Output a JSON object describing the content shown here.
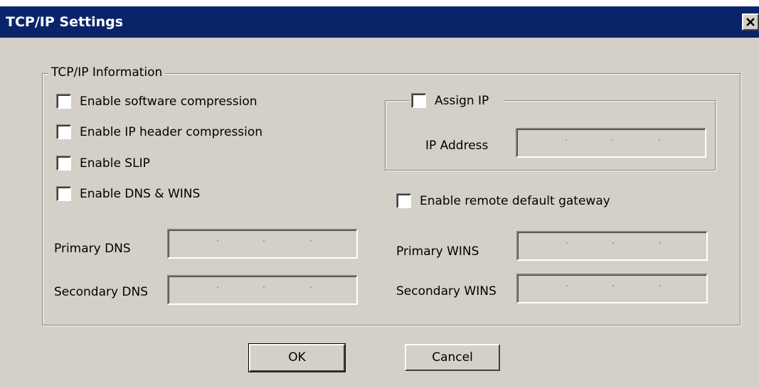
{
  "window": {
    "title": "TCP/IP Settings",
    "close_glyph": "×",
    "icon": "close-icon"
  },
  "group": {
    "title": "TCP/IP Information"
  },
  "options": {
    "software_compression": "Enable software compression",
    "ip_header_compression": "Enable IP header compression",
    "slip": "Enable SLIP",
    "dns_wins": "Enable DNS & WINS",
    "remote_gateway": "Enable remote default gateway"
  },
  "assign_ip": {
    "label": "Assign IP",
    "ip_address_label": "IP Address"
  },
  "dns": {
    "primary_label": "Primary DNS",
    "secondary_label": "Secondary DNS"
  },
  "wins": {
    "primary_label": "Primary WINS",
    "secondary_label": "Secondary WINS"
  },
  "buttons": {
    "ok": "OK",
    "cancel": "Cancel"
  },
  "colors": {
    "titlebar": "#0a246a",
    "face": "#d4d0c8"
  }
}
